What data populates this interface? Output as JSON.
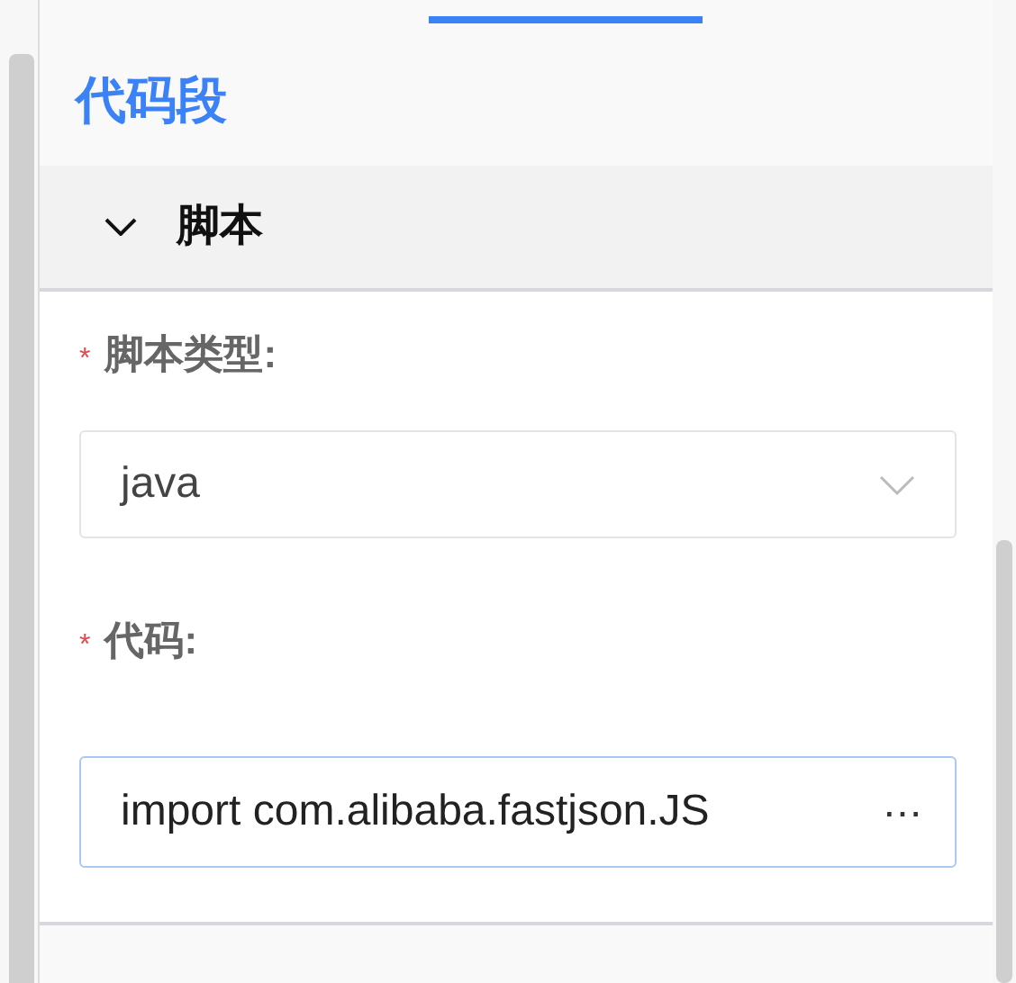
{
  "title": "代码段",
  "section": {
    "title": "脚本",
    "expanded": true,
    "fields": [
      {
        "kind": "select",
        "label": "脚本类型:",
        "required_mark": "*",
        "value": "java"
      },
      {
        "kind": "input",
        "label": "代码:",
        "required_mark": "*",
        "value": "import com.alibaba.fastjson.JS",
        "more": "⋯"
      }
    ]
  }
}
